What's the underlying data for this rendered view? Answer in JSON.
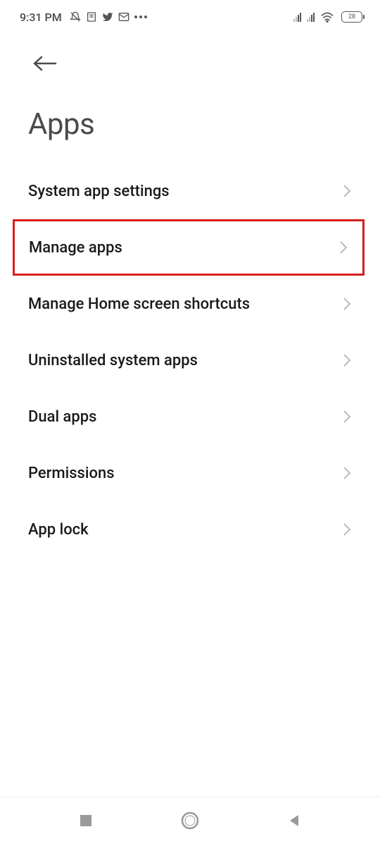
{
  "status_bar": {
    "time": "9:31 PM",
    "battery_level": "28"
  },
  "page": {
    "title": "Apps"
  },
  "menu_items": [
    {
      "label": "System app settings",
      "highlighted": false
    },
    {
      "label": "Manage apps",
      "highlighted": true
    },
    {
      "label": "Manage Home screen shortcuts",
      "highlighted": false
    },
    {
      "label": "Uninstalled system apps",
      "highlighted": false
    },
    {
      "label": "Dual apps",
      "highlighted": false
    },
    {
      "label": "Permissions",
      "highlighted": false
    },
    {
      "label": "App lock",
      "highlighted": false
    }
  ]
}
